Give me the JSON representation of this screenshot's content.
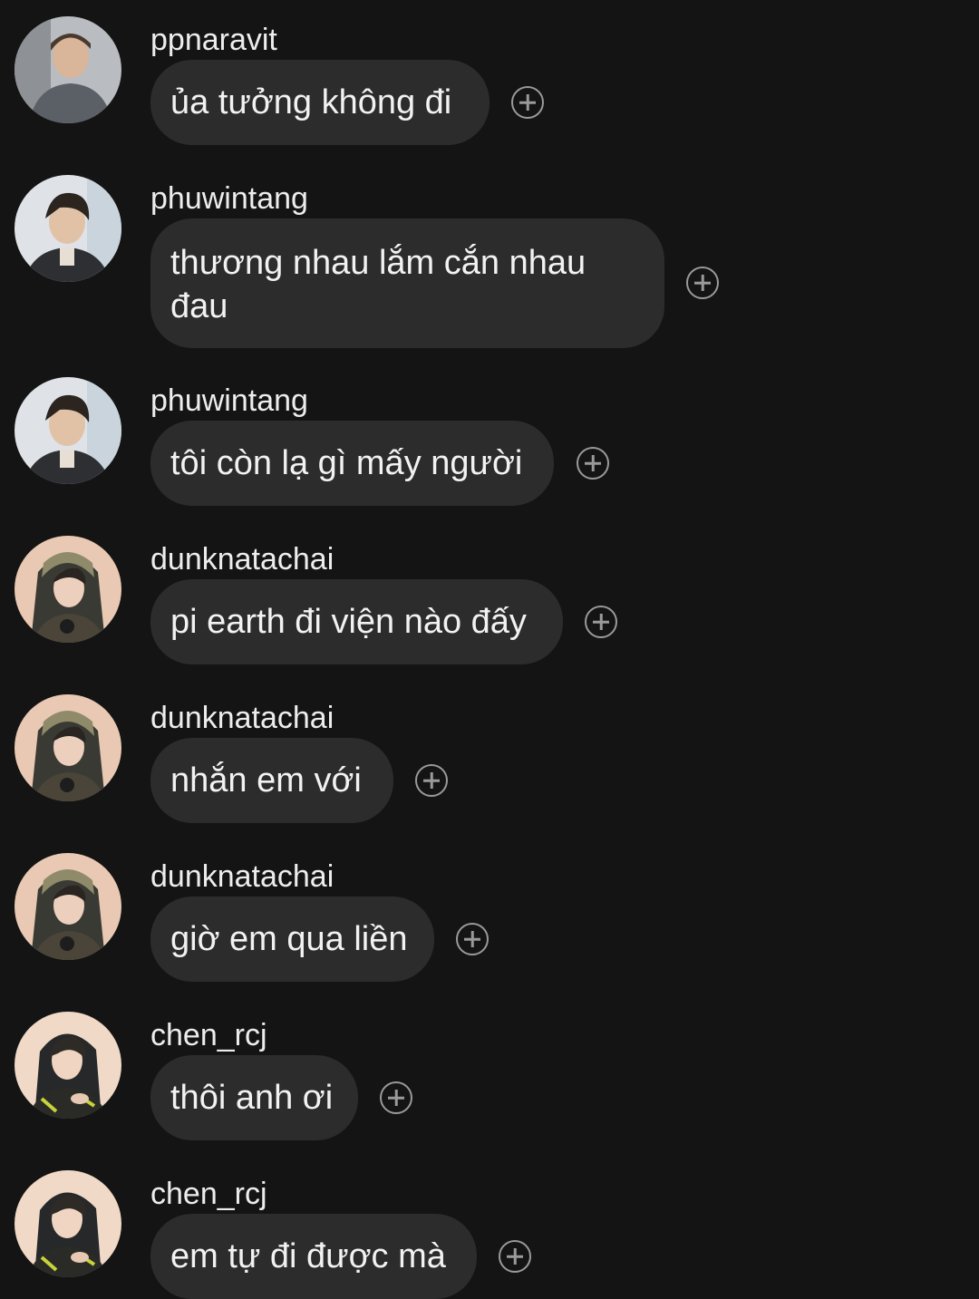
{
  "messages": [
    {
      "username": "ppnaravit",
      "text": "ủa tưởng không đi",
      "avatar": "ppnaravit-avatar"
    },
    {
      "username": "phuwintang",
      "text": "thương nhau lắm cắn nhau đau",
      "avatar": "phuwintang-avatar"
    },
    {
      "username": "phuwintang",
      "text": "tôi còn lạ gì mấy người",
      "avatar": "phuwintang-avatar"
    },
    {
      "username": "dunknatachai",
      "text": "pi earth đi viện nào đấy",
      "avatar": "dunknatachai-avatar"
    },
    {
      "username": "dunknatachai",
      "text": "nhắn em với",
      "avatar": "dunknatachai-avatar"
    },
    {
      "username": "dunknatachai",
      "text": "giờ em qua liền",
      "avatar": "dunknatachai-avatar"
    },
    {
      "username": "chen_rcj",
      "text": "thôi anh ơi",
      "avatar": "chen_rcj-avatar"
    },
    {
      "username": "chen_rcj",
      "text": "em tự đi được mà",
      "avatar": "chen_rcj-avatar"
    }
  ],
  "icons": {
    "add_reaction": "plus-circle-icon"
  },
  "colors": {
    "background": "#141414",
    "bubble": "#2c2c2c",
    "text": "#f2f2f2",
    "icon": "#9a9a9a"
  }
}
